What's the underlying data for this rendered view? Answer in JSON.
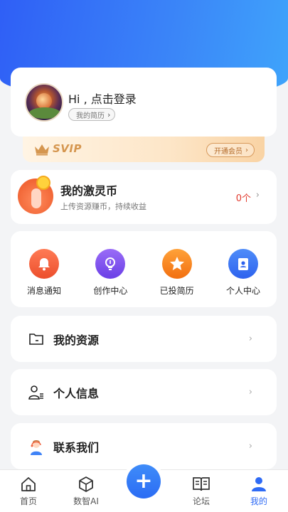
{
  "profile": {
    "greeting": "Hi , 点击登录",
    "resume_label": "我的简历",
    "chevron": "›"
  },
  "svip": {
    "label": "SVIP",
    "open_label": "开通会员",
    "chevron": "›"
  },
  "coin": {
    "title": "我的激灵币",
    "subtitle": "上传资源赚币，持续收益",
    "count": "0个",
    "arrow": "›"
  },
  "quick_actions": [
    {
      "label": "消息通知",
      "icon": "bell-icon",
      "color": "#f0633f"
    },
    {
      "label": "创作中心",
      "icon": "lightbulb-icon",
      "color": "#7b54ef"
    },
    {
      "label": "已投简历",
      "icon": "star-icon",
      "color": "#f7821e"
    },
    {
      "label": "个人中心",
      "icon": "id-card-icon",
      "color": "#2f6bf5"
    }
  ],
  "menu": [
    {
      "label": "我的资源",
      "icon": "folder-icon",
      "arrow": "›"
    },
    {
      "label": "个人信息",
      "icon": "user-info-icon",
      "arrow": "›"
    },
    {
      "label": "联系我们",
      "icon": "support-agent-icon",
      "arrow": "›"
    }
  ],
  "tabbar": {
    "items": [
      {
        "label": "首页",
        "icon": "home-icon"
      },
      {
        "label": "数智AI",
        "icon": "cube-icon"
      },
      {
        "label": "论坛",
        "icon": "book-icon"
      },
      {
        "label": "我的",
        "icon": "person-icon",
        "active": true
      }
    ],
    "fab": "+"
  },
  "colors": {
    "accent": "#2f6bf5",
    "coin_count": "#e23b2f",
    "svip_gold": "#d5964f"
  }
}
